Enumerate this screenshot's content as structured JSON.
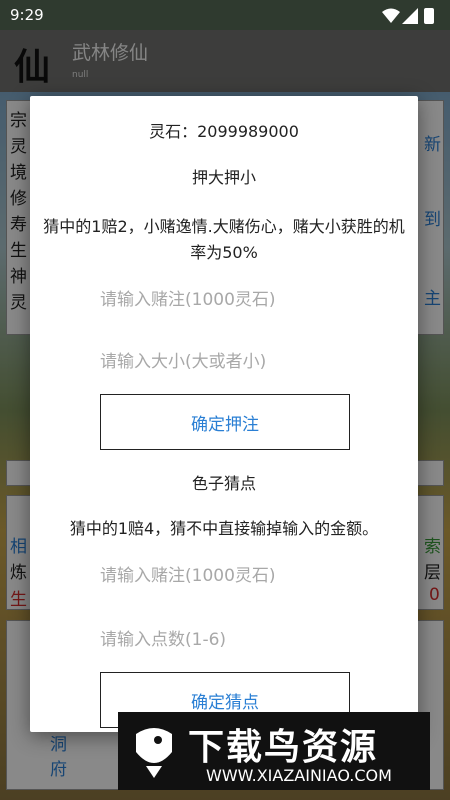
{
  "status_bar": {
    "time": "9:29"
  },
  "header": {
    "logo": "仙",
    "title": "武林修仙",
    "subtitle": "null"
  },
  "background": {
    "left_column": [
      "宗",
      "灵",
      "境",
      "修",
      "寿",
      "生",
      "神",
      "灵"
    ],
    "right_snippets": [
      "新",
      "到",
      "主",
      "索",
      "层",
      "0"
    ],
    "lower_left": [
      "相",
      "炼",
      "生"
    ],
    "bottom_left": [
      "洞",
      "府"
    ]
  },
  "dialog": {
    "spirit_stone": "灵石：2099989000",
    "bet_big_small": {
      "title": "押大押小",
      "description": "猜中的1赔2，小赌逸情.大赌伤心，赌大小获胜的机率为50%",
      "amount_placeholder": "请输入赌注(1000灵石)",
      "choice_placeholder": "请输入大小(大或者小)",
      "confirm_label": "确定押注"
    },
    "dice_guess": {
      "title": "色子猜点",
      "description": "猜中的1赔4，猜不中直接输掉输入的金额。",
      "amount_placeholder": "请输入赌注(1000灵石)",
      "points_placeholder": "请输入点数(1-6)",
      "confirm_label": "确定猜点"
    }
  },
  "watermark": {
    "title": "下载鸟资源",
    "url": "WWW.XIAZAINIAO.COM"
  }
}
